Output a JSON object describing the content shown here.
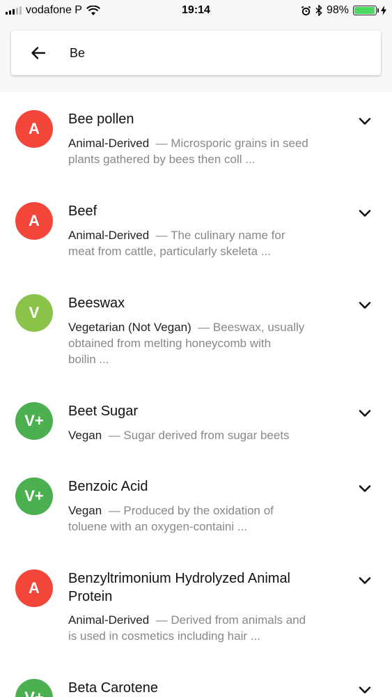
{
  "status_bar": {
    "carrier": "vodafone P",
    "time": "19:14",
    "battery": "98%",
    "battery_level": 0.98
  },
  "search": {
    "value": "Be"
  },
  "colors": {
    "animal": "#f2463b",
    "vegetarian": "#8bc34a",
    "vegan": "#4caf50"
  },
  "items": [
    {
      "badge": "A",
      "title_line1": "Bee pollen",
      "title_line2": "",
      "category": "Animal-Derived",
      "dash": "—",
      "desc_line1": "Microsporic grains in seed",
      "desc_line2": "plants gathered by bees then coll ...",
      "desc_line3": ""
    },
    {
      "badge": "A",
      "title_line1": "Beef",
      "title_line2": "",
      "category": "Animal-Derived",
      "dash": "—",
      "desc_line1": "The culinary name for",
      "desc_line2": "meat from cattle, particularly skeleta ...",
      "desc_line3": ""
    },
    {
      "badge": "V",
      "title_line1": "Beeswax",
      "title_line2": "",
      "category": "Vegetarian (Not Vegan)",
      "dash": "—",
      "desc_line1": "Beeswax, usually",
      "desc_line2": "obtained from melting honeycomb with",
      "desc_line3": "boilin ..."
    },
    {
      "badge": "V+",
      "title_line1": "Beet Sugar",
      "title_line2": "",
      "category": "Vegan",
      "dash": "—",
      "desc_line1": "Sugar derived from sugar beets",
      "desc_line2": "",
      "desc_line3": ""
    },
    {
      "badge": "V+",
      "title_line1": "Benzoic Acid",
      "title_line2": "",
      "category": "Vegan",
      "dash": "—",
      "desc_line1": "Produced by the oxidation of",
      "desc_line2": "toluene with an oxygen-containi ...",
      "desc_line3": ""
    },
    {
      "badge": "A",
      "title_line1": "Benzyltrimonium Hydrolyzed Animal",
      "title_line2": "Protein",
      "category": "Animal-Derived",
      "dash": "—",
      "desc_line1": "Derived from animals and",
      "desc_line2": "is used in cosmetics including hair ...",
      "desc_line3": ""
    },
    {
      "badge": "V+",
      "title_line1": "Beta Carotene",
      "title_line2": "",
      "category": "",
      "dash": "",
      "desc_line1": "",
      "desc_line2": "",
      "desc_line3": ""
    }
  ]
}
